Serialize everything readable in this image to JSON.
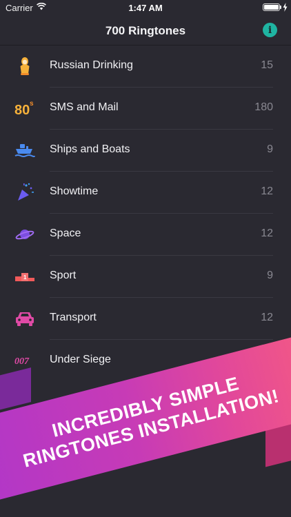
{
  "status_bar": {
    "carrier": "Carrier",
    "time": "1:47 AM"
  },
  "nav": {
    "title": "700 Ringtones",
    "info_icon": "i"
  },
  "list": {
    "items": [
      {
        "label": "Russian Drinking",
        "count": "15",
        "icon": "matryoshka-icon"
      },
      {
        "label": "SMS and Mail",
        "count": "180",
        "icon": "80s-icon"
      },
      {
        "label": "Ships and Boats",
        "count": "9",
        "icon": "ship-icon"
      },
      {
        "label": "Showtime",
        "count": "12",
        "icon": "party-popper-icon"
      },
      {
        "label": "Space",
        "count": "12",
        "icon": "planet-icon"
      },
      {
        "label": "Sport",
        "count": "9",
        "icon": "podium-icon"
      },
      {
        "label": "Transport",
        "count": "12",
        "icon": "car-icon"
      },
      {
        "label": "Under Siege",
        "count": "",
        "icon": "007-icon",
        "icon_text": "007"
      }
    ]
  },
  "banner": {
    "line1": "INCREDIBLY SIMPLE",
    "line2": "RINGTONES INSTALLATION!"
  },
  "colors": {
    "background": "#2a2931",
    "info_accent": "#1fb4a2",
    "ribbon_start": "#b237c7",
    "ribbon_end": "#f25886"
  }
}
